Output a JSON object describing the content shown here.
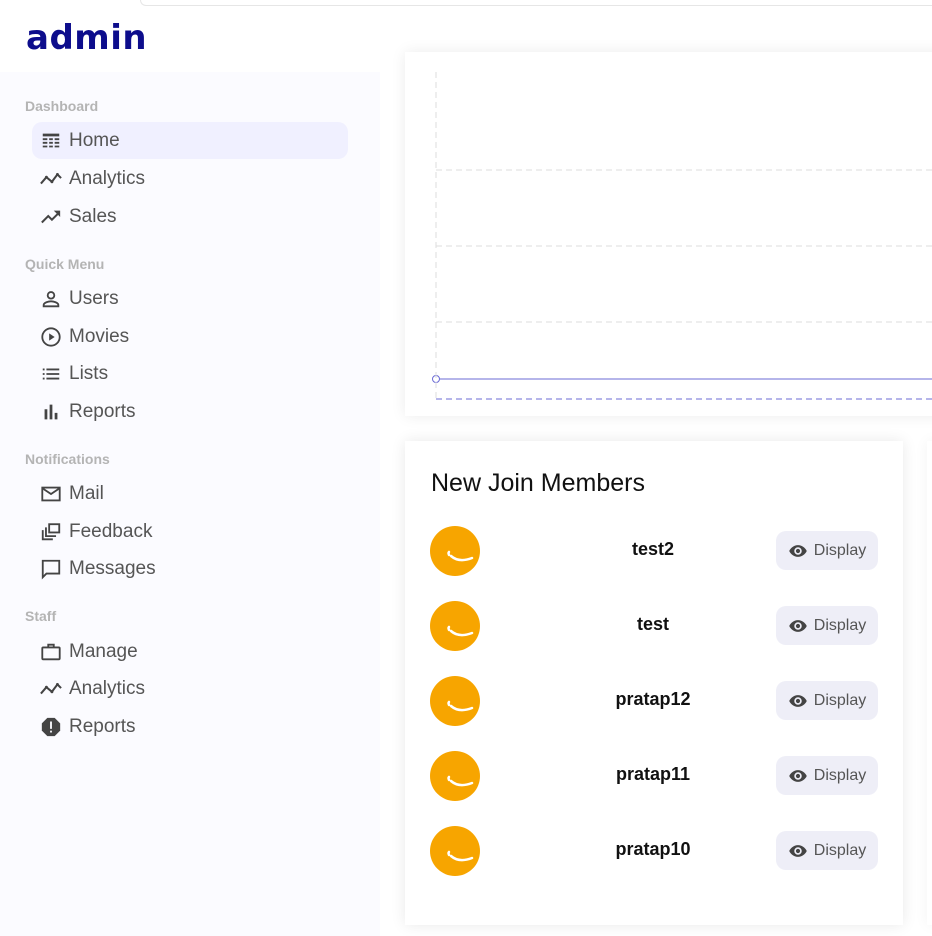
{
  "app": {
    "logo": "admin"
  },
  "sidebar": {
    "sections": [
      {
        "title": "Dashboard",
        "items": [
          {
            "label": "Home",
            "icon": "home-icon",
            "active": true
          },
          {
            "label": "Analytics",
            "icon": "timeline-icon"
          },
          {
            "label": "Sales",
            "icon": "trending-up-icon"
          }
        ]
      },
      {
        "title": "Quick Menu",
        "items": [
          {
            "label": "Users",
            "icon": "person-outline-icon"
          },
          {
            "label": "Movies",
            "icon": "play-circle-icon"
          },
          {
            "label": "Lists",
            "icon": "list-icon"
          },
          {
            "label": "Reports",
            "icon": "bar-chart-icon"
          }
        ]
      },
      {
        "title": "Notifications",
        "items": [
          {
            "label": "Mail",
            "icon": "mail-outline-icon"
          },
          {
            "label": "Feedback",
            "icon": "dynamic-feed-icon"
          },
          {
            "label": "Messages",
            "icon": "chat-bubble-outline-icon"
          }
        ]
      },
      {
        "title": "Staff",
        "items": [
          {
            "label": "Manage",
            "icon": "work-outline-icon"
          },
          {
            "label": "Analytics",
            "icon": "timeline-icon"
          },
          {
            "label": "Reports",
            "icon": "report-icon"
          }
        ]
      }
    ]
  },
  "members": {
    "title": "New Join Members",
    "button_label": "Display",
    "list": [
      {
        "username": "test2"
      },
      {
        "username": "test"
      },
      {
        "username": "pratap12"
      },
      {
        "username": "pratap11"
      },
      {
        "username": "pratap10"
      }
    ]
  },
  "colors": {
    "logo": "#0d0d8c",
    "avatar": "#f7a500",
    "active_nav_bg": "#f0f0ff",
    "chart_line": "#6b6bd6"
  }
}
